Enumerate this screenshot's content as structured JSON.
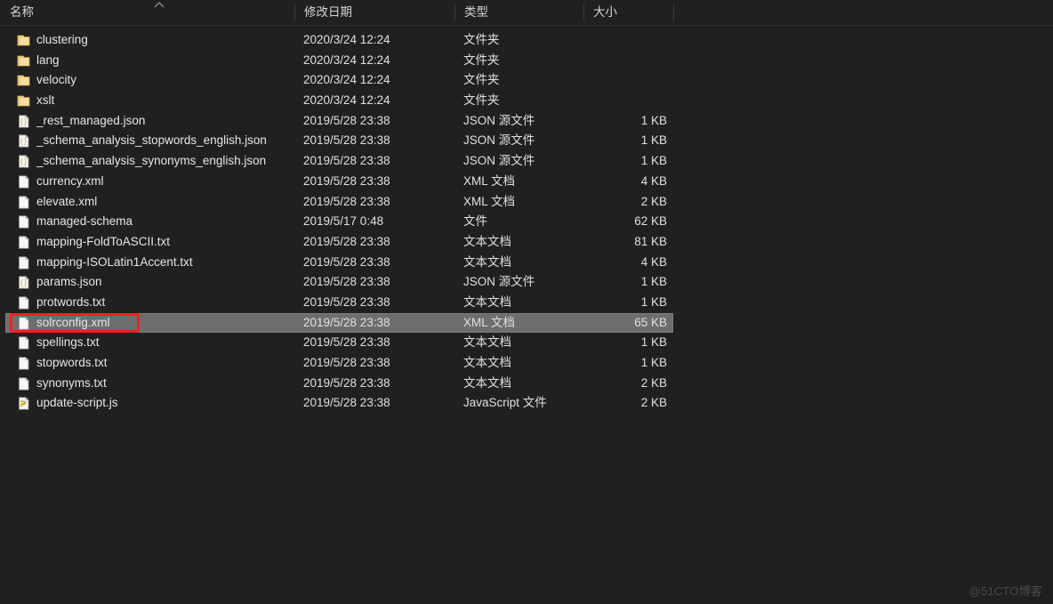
{
  "window": {
    "background_color": "#202020",
    "text_color": "#e8e8e8",
    "selection_color": "#6e6e6e",
    "annotation_color": "#ee2222"
  },
  "columns": {
    "headers": [
      {
        "label": "名称",
        "key": "name",
        "sorted": true,
        "sort_direction": "ascending"
      },
      {
        "label": "修改日期",
        "key": "date",
        "sorted": false,
        "sort_direction": ""
      },
      {
        "label": "类型",
        "key": "type",
        "sorted": false,
        "sort_direction": ""
      },
      {
        "label": "大小",
        "key": "size",
        "sorted": false,
        "sort_direction": ""
      }
    ]
  },
  "files": [
    {
      "name": "clustering",
      "date": "2020/3/24 12:24",
      "type": "文件夹",
      "size": "",
      "icon": "folder-icon",
      "selected": false
    },
    {
      "name": "lang",
      "date": "2020/3/24 12:24",
      "type": "文件夹",
      "size": "",
      "icon": "folder-icon",
      "selected": false
    },
    {
      "name": "velocity",
      "date": "2020/3/24 12:24",
      "type": "文件夹",
      "size": "",
      "icon": "folder-icon",
      "selected": false
    },
    {
      "name": "xslt",
      "date": "2020/3/24 12:24",
      "type": "文件夹",
      "size": "",
      "icon": "folder-icon",
      "selected": false
    },
    {
      "name": "_rest_managed.json",
      "date": "2019/5/28 23:38",
      "type": "JSON 源文件",
      "size": "1 KB",
      "icon": "json-file-icon",
      "selected": false
    },
    {
      "name": "_schema_analysis_stopwords_english.json",
      "date": "2019/5/28 23:38",
      "type": "JSON 源文件",
      "size": "1 KB",
      "icon": "json-file-icon",
      "selected": false
    },
    {
      "name": "_schema_analysis_synonyms_english.json",
      "date": "2019/5/28 23:38",
      "type": "JSON 源文件",
      "size": "1 KB",
      "icon": "json-file-icon",
      "selected": false
    },
    {
      "name": "currency.xml",
      "date": "2019/5/28 23:38",
      "type": "XML 文档",
      "size": "4 KB",
      "icon": "xml-file-icon",
      "selected": false
    },
    {
      "name": "elevate.xml",
      "date": "2019/5/28 23:38",
      "type": "XML 文档",
      "size": "2 KB",
      "icon": "xml-file-icon",
      "selected": false
    },
    {
      "name": "managed-schema",
      "date": "2019/5/17 0:48",
      "type": "文件",
      "size": "62 KB",
      "icon": "generic-file-icon",
      "selected": false
    },
    {
      "name": "mapping-FoldToASCII.txt",
      "date": "2019/5/28 23:38",
      "type": "文本文档",
      "size": "81 KB",
      "icon": "text-file-icon",
      "selected": false
    },
    {
      "name": "mapping-ISOLatin1Accent.txt",
      "date": "2019/5/28 23:38",
      "type": "文本文档",
      "size": "4 KB",
      "icon": "text-file-icon",
      "selected": false
    },
    {
      "name": "params.json",
      "date": "2019/5/28 23:38",
      "type": "JSON 源文件",
      "size": "1 KB",
      "icon": "json-file-icon",
      "selected": false
    },
    {
      "name": "protwords.txt",
      "date": "2019/5/28 23:38",
      "type": "文本文档",
      "size": "1 KB",
      "icon": "text-file-icon",
      "selected": false
    },
    {
      "name": "solrconfig.xml",
      "date": "2019/5/28 23:38",
      "type": "XML 文档",
      "size": "65 KB",
      "icon": "xml-file-icon",
      "selected": true
    },
    {
      "name": "spellings.txt",
      "date": "2019/5/28 23:38",
      "type": "文本文档",
      "size": "1 KB",
      "icon": "text-file-icon",
      "selected": false
    },
    {
      "name": "stopwords.txt",
      "date": "2019/5/28 23:38",
      "type": "文本文档",
      "size": "1 KB",
      "icon": "text-file-icon",
      "selected": false
    },
    {
      "name": "synonyms.txt",
      "date": "2019/5/28 23:38",
      "type": "文本文档",
      "size": "2 KB",
      "icon": "text-file-icon",
      "selected": false
    },
    {
      "name": "update-script.js",
      "date": "2019/5/28 23:38",
      "type": "JavaScript 文件",
      "size": "2 KB",
      "icon": "js-file-icon",
      "selected": false
    }
  ],
  "annotation": {
    "target_file": "solrconfig.xml",
    "color": "#ee2222"
  },
  "watermark": {
    "text": "@51CTO博客"
  }
}
